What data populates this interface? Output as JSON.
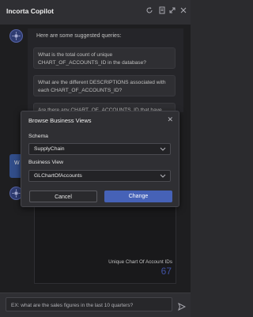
{
  "header": {
    "title": "Incorta Copilot",
    "icons": [
      "refresh-icon",
      "document-icon",
      "expand-icon",
      "close-icon"
    ]
  },
  "chat": {
    "intro": "Here are some suggested queries:",
    "suggestions": [
      "What is the total count of unique CHART_OF_ACCOUNTS_ID in the database?",
      "What are the different DESCRIPTIONS associated with each CHART_OF_ACCOUNTS_ID?",
      "Are there any CHART_OF_ACCOUNTS_ID that have"
    ],
    "user_bubble": "W",
    "kpi": {
      "label": "Unique Chart Of Account IDs",
      "value": "67"
    }
  },
  "modal": {
    "title": "Browse Business Views",
    "schema_label": "Schema",
    "schema_value": "SupplyChain",
    "view_label": "Business View",
    "view_value": "GLChartOfAccounts",
    "cancel_label": "Cancel",
    "change_label": "Change"
  },
  "input": {
    "placeholder": "EX: what are the sales figures in the last 10 quarters?"
  },
  "colors": {
    "accent": "#4662b7",
    "background": "#252528"
  }
}
